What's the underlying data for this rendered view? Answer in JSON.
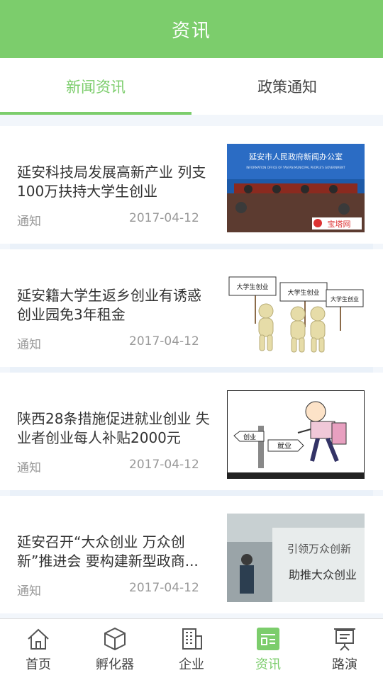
{
  "header": {
    "title": "资讯"
  },
  "tabs": [
    {
      "label": "新闻资讯",
      "active": true
    },
    {
      "label": "政策通知",
      "active": false
    }
  ],
  "news": [
    {
      "title": "延安科技局发展高新产业 列支100万扶持大学生创业",
      "tag": "通知",
      "date": "2017-04-12",
      "thumb_text": {
        "banner": "延安市人民政府新闻办公室",
        "banner_en": "INFORMATION OFFICE OF YAN'AN MUNICIPAL PEOPLE'S GOVERNMENT",
        "logo": "宝塔网"
      }
    },
    {
      "title": "延安籍大学生返乡创业有诱惑 创业园免3年租金",
      "tag": "通知",
      "date": "2017-04-12",
      "thumb_text": {
        "sign": "大学生创业"
      }
    },
    {
      "title": "陕西28条措施促进就业创业 失业者创业每人补贴2000元",
      "tag": "通知",
      "date": "2017-04-12",
      "thumb_text": {
        "sign1": "创业",
        "sign2": "就业"
      }
    },
    {
      "title": "延安召开“大众创业 万众创新”推进会 要构建新型政商...",
      "tag": "通知",
      "date": "2017-04-12",
      "thumb_text": {
        "line1": "引领万众创新",
        "line2": "助推大众创业"
      }
    }
  ],
  "bottom_nav": [
    {
      "label": "首页",
      "icon": "home-icon",
      "active": false
    },
    {
      "label": "孵化器",
      "icon": "cube-icon",
      "active": false
    },
    {
      "label": "企业",
      "icon": "building-icon",
      "active": false
    },
    {
      "label": "资讯",
      "icon": "news-icon",
      "active": true
    },
    {
      "label": "路演",
      "icon": "presentation-icon",
      "active": false
    }
  ],
  "colors": {
    "accent": "#7ccd6c",
    "background": "#f2f6fb"
  }
}
